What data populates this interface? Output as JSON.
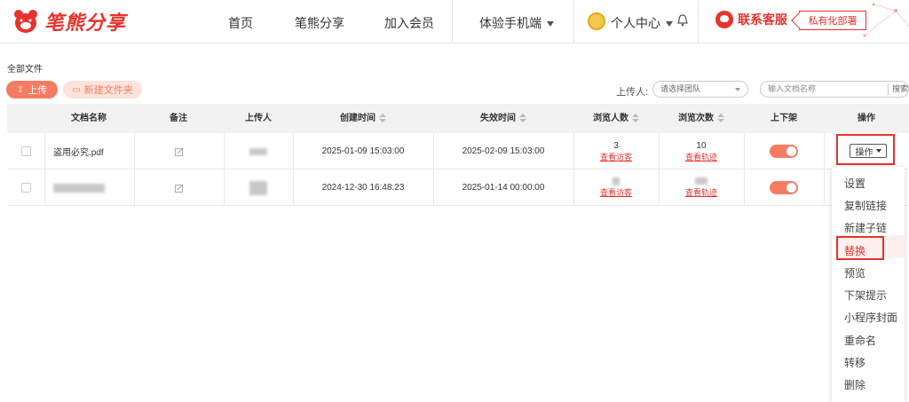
{
  "header": {
    "logo_text": "笔熊分享",
    "nav": [
      "首页",
      "笔熊分享",
      "加入会员",
      "体验手机端"
    ],
    "personal_center": "个人中心",
    "service": "联系客服",
    "private_deploy": "私有化部署"
  },
  "toolbar": {
    "breadcrumb": "全部文件",
    "upload_label": "上传",
    "new_folder_label": "新建文件夹",
    "uploader_label": "上传人:",
    "uploader_placeholder": "请选择团队",
    "search_placeholder": "输入文档名称",
    "search_button": "搜索"
  },
  "table": {
    "columns": [
      "文档名称",
      "备注",
      "上传人",
      "创建时间",
      "失效时间",
      "浏览人数",
      "浏览次数",
      "上下架",
      "操作"
    ],
    "rows": [
      {
        "name": "盗用必究.pdf",
        "created": "2025-01-09 15:03:00",
        "expires": "2025-02-09 15:03:00",
        "viewers": "3",
        "viewers_link": "查看访客",
        "views": "10",
        "views_link": "查看轨迹",
        "published": true,
        "action_label": "操作"
      },
      {
        "name": "",
        "created": "2024-12-30 16:48:23",
        "expires": "2025-01-14 00:00:00",
        "viewers": "",
        "viewers_link": "查看访客",
        "views": "",
        "views_link": "查看轨迹",
        "published": true
      }
    ]
  },
  "action_menu": {
    "items": [
      "设置",
      "复制链接",
      "新建子链",
      "替换",
      "预览",
      "下架提示",
      "小程序封面",
      "重命名",
      "转移",
      "删除"
    ],
    "highlighted": "替换"
  },
  "colors": {
    "brand": "#e8322c",
    "accent": "#f47c62"
  }
}
